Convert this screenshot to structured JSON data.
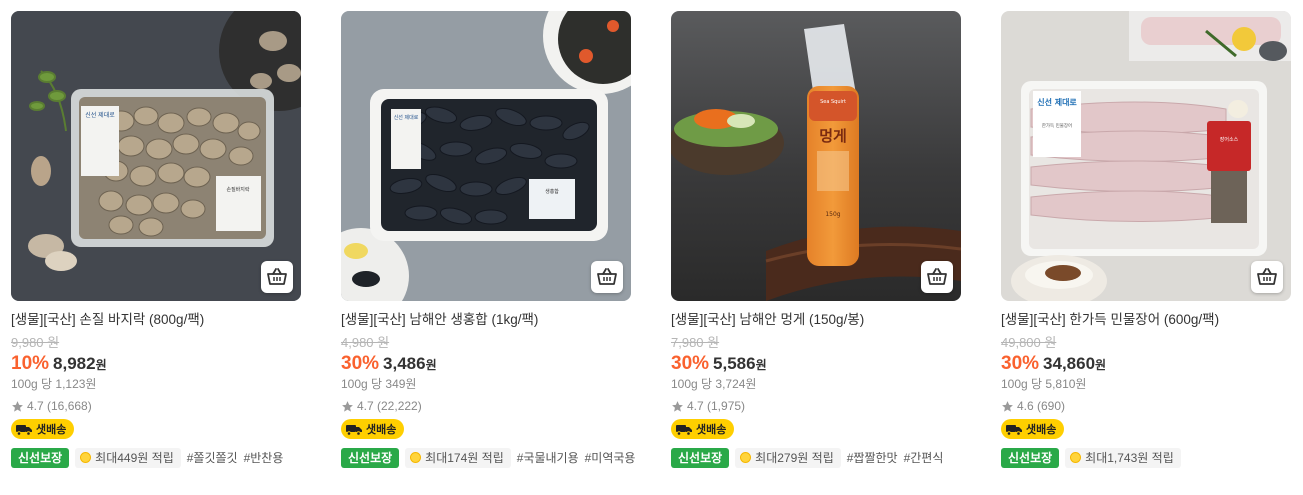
{
  "products": [
    {
      "title": "[생물][국산] 손질 바지락 (800g/팩)",
      "original_price": "9,980 원",
      "discount_rate": "10%",
      "price": "8,982",
      "currency": "원",
      "unit_price": "100g 당 1,123원",
      "rating": "4.7 (16,668)",
      "delivery": "샛배송",
      "fresh_badge": "신선보장",
      "points": "최대449원 적립",
      "hashtags": [
        "#쫄깃쫄깃",
        "#반찬용"
      ]
    },
    {
      "title": "[생물][국산] 남해안 생홍합 (1kg/팩)",
      "original_price": "4,980 원",
      "discount_rate": "30%",
      "price": "3,486",
      "currency": "원",
      "unit_price": "100g 당 349원",
      "rating": "4.7 (22,222)",
      "delivery": "샛배송",
      "fresh_badge": "신선보장",
      "points": "최대174원 적립",
      "hashtags": [
        "#국물내기용",
        "#미역국용"
      ]
    },
    {
      "title": "[생물][국산] 남해안 멍게 (150g/봉)",
      "original_price": "7,980 원",
      "discount_rate": "30%",
      "price": "5,586",
      "currency": "원",
      "unit_price": "100g 당 3,724원",
      "rating": "4.7 (1,975)",
      "delivery": "샛배송",
      "fresh_badge": "신선보장",
      "points": "최대279원 적립",
      "hashtags": [
        "#짭짤한맛",
        "#간편식"
      ]
    },
    {
      "title": "[생물][국산] 한가득 민물장어 (600g/팩)",
      "original_price": "49,800 원",
      "discount_rate": "30%",
      "price": "34,860",
      "currency": "원",
      "unit_price": "100g 당 5,810원",
      "rating": "4.6 (690)",
      "delivery": "샛배송",
      "fresh_badge": "신선보장",
      "points": "최대1,743원 적립",
      "hashtags": []
    }
  ],
  "image_labels": {
    "clam_pack": [
      "신선 제대로",
      "손질바지락"
    ],
    "mussel_pack": [
      "신선 제대로",
      "생홍합"
    ],
    "squirt_pack": [
      "Sea Squirt",
      "멍게",
      "150g"
    ],
    "eel_pack": [
      "신선 제대로",
      "한가득 민물장어",
      "장어소스"
    ]
  },
  "icons": {
    "cart": "basket-icon",
    "star": "star-icon",
    "delivery": "delivery-truck-icon",
    "points": "coin-icon"
  },
  "colors": {
    "discount": "#fa622f",
    "fresh_badge": "#2aa948",
    "delivery_badge": "#ffcf00"
  }
}
